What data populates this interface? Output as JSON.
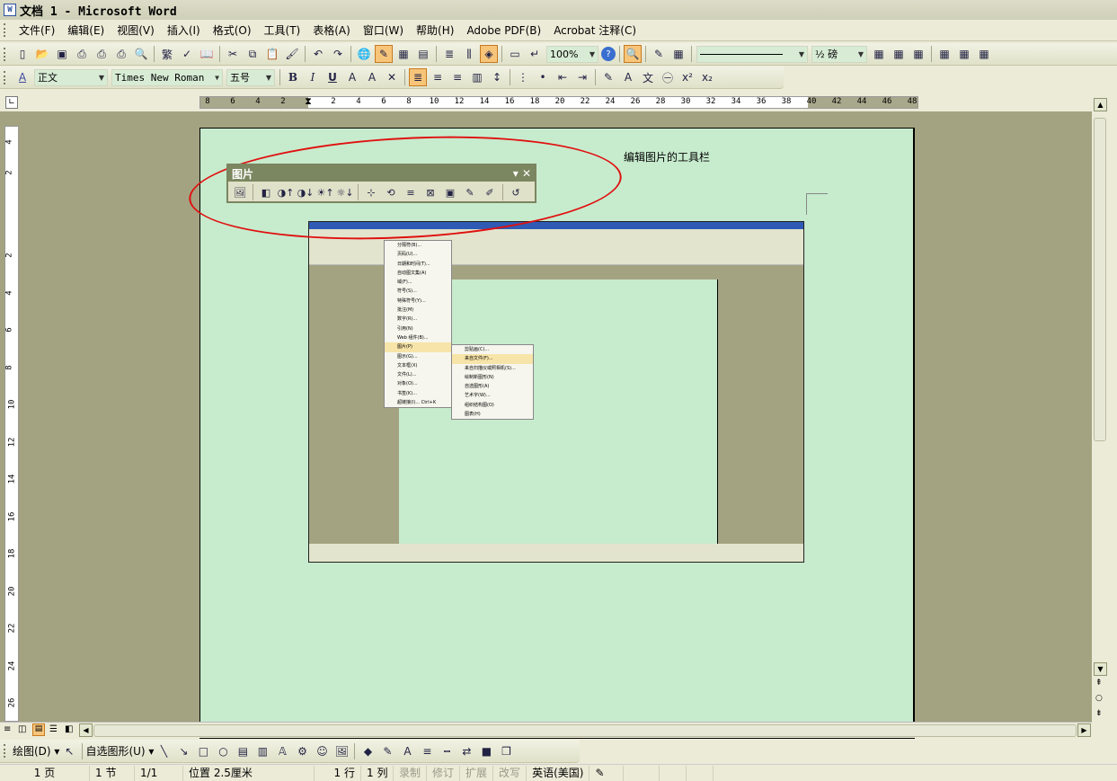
{
  "window": {
    "title": "文档 1 - Microsoft Word",
    "app_icon": "W"
  },
  "menu": [
    "文件(F)",
    "编辑(E)",
    "视图(V)",
    "插入(I)",
    "格式(O)",
    "工具(T)",
    "表格(A)",
    "窗口(W)",
    "帮助(H)",
    "Adobe PDF(B)",
    "Acrobat 注释(C)"
  ],
  "standard_toolbar": {
    "icons": [
      "new-doc",
      "open",
      "save",
      "permission",
      "print-preview-lock",
      "print",
      "print-preview",
      "sep",
      "traditional-chinese",
      "spelling",
      "research",
      "sep",
      "cut",
      "copy",
      "paste",
      "format-painter",
      "sep",
      "undo",
      "redo",
      "sep",
      "hyperlink",
      "drawing-toggle",
      "table",
      "excel",
      "sep",
      "columns",
      "text-direction",
      "drawing-active",
      "sep",
      "document-map",
      "show-formatting"
    ],
    "zoom": "100%",
    "line_style_value": "",
    "line_weight": "½ 磅",
    "help": "?"
  },
  "format_toolbar": {
    "style": "正文",
    "font": "Times New Roman",
    "size": "五号",
    "bold": "B",
    "italic": "I",
    "underline": "U"
  },
  "ruler": {
    "h_ticks": [
      "8",
      "6",
      "4",
      "2",
      "2",
      "4",
      "6",
      "8",
      "10",
      "12",
      "14",
      "16",
      "18",
      "20",
      "22",
      "24",
      "26",
      "28",
      "30",
      "32",
      "34",
      "36",
      "38",
      "40",
      "42",
      "44",
      "46",
      "48"
    ],
    "v_ticks": [
      "4",
      "2",
      "2",
      "4",
      "6",
      "8",
      "10",
      "12",
      "14",
      "16",
      "18",
      "20",
      "22",
      "24",
      "26"
    ]
  },
  "annotation": {
    "caption": "编辑图片的工具栏"
  },
  "picture_toolbar": {
    "title": "图片",
    "icons": [
      "insert-picture",
      "color",
      "more-contrast",
      "less-contrast",
      "more-brightness",
      "less-brightness",
      "crop",
      "rotate-left",
      "line-style",
      "compress-pictures",
      "text-wrapping",
      "format-picture",
      "set-transparent-color",
      "reset-picture"
    ]
  },
  "embedded_screenshot": {
    "insert_menu": [
      "分隔符(B)...",
      "页码(U)...",
      "日期和时间(T)...",
      "自动图文集(A)",
      "域(F)...",
      "符号(S)...",
      "特殊符号(Y)...",
      "批注(M)",
      "数字(R)...",
      "引用(N)",
      "Web 组件(B)...",
      "图片(P)",
      "图示(G)...",
      "文本框(X)",
      "文件(L)...",
      "对象(O)...",
      "书签(K)...",
      "超链接(I)...  Ctrl+K"
    ],
    "picture_submenu": [
      "剪贴画(C)...",
      "来自文件(F)...",
      "来自扫描仪或照相机(S)...",
      "绘制新图形(N)",
      "自选图形(A)",
      "艺术字(W)...",
      "组织结构图(O)",
      "图表(H)"
    ]
  },
  "drawing_toolbar": {
    "draw": "绘图(D) ▾",
    "autoshapes": "自选图形(U) ▾"
  },
  "status": {
    "page": "1 页",
    "section": "1 节",
    "pages": "1/1",
    "position": "位置 2.5厘米",
    "line": "1 行",
    "column": "1 列",
    "rec": "录制",
    "trk": "修订",
    "ext": "扩展",
    "ovr": "改写",
    "language": "英语(美国)"
  }
}
